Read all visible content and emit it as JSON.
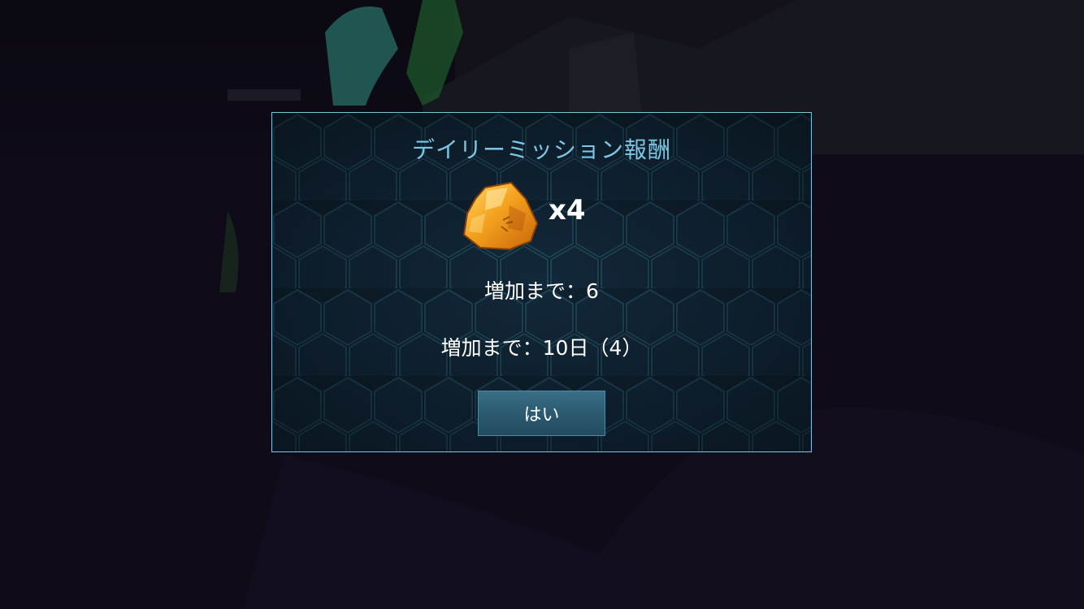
{
  "dialog": {
    "title": "デイリーミッション報酬",
    "reward": {
      "item_icon": "amber-icon",
      "quantity_label": "x4"
    },
    "info_lines": [
      "増加まで：6",
      "増加まで：10日（4）"
    ],
    "confirm_label": "はい"
  },
  "colors": {
    "title": "#7cc6e6",
    "dialog_border": "#7fc4e0",
    "dialog_bg": "#0f2230",
    "button": "#2c5a70",
    "amber": "#f0a020"
  }
}
